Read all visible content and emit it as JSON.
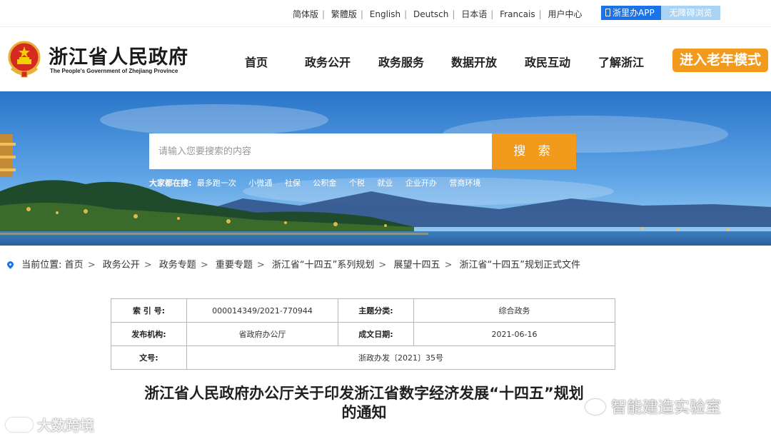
{
  "topbar": {
    "languages": [
      "简体版",
      "繁體版",
      "English",
      "Deutsch",
      "日本语",
      "Francais",
      "用户中心"
    ],
    "app_button": "浙里办APP",
    "accessibility_button": "无障碍浏览"
  },
  "header": {
    "title": "浙江省人民政府",
    "subtitle": "The People's Government of Zhejiang Province",
    "nav": [
      "首页",
      "政务公开",
      "政务服务",
      "数据开放",
      "政民互动",
      "了解浙江"
    ],
    "elder_mode": "进入老年模式"
  },
  "search": {
    "placeholder": "请输入您要搜索的内容",
    "button": "搜 索",
    "hot_label": "大家都在搜:",
    "hot_items": [
      "最多跑一次",
      "小微通",
      "社保",
      "公积金",
      "个税",
      "就业",
      "企业开办",
      "营商环境"
    ]
  },
  "breadcrumb": {
    "label": "当前位置:",
    "items": [
      "首页",
      "政务公开",
      "政务专题",
      "重要专题",
      "浙江省“十四五”系列规划",
      "展望十四五",
      "浙江省“十四五”规划正式文件"
    ]
  },
  "info_table": {
    "index_label": "索 引 号:",
    "index_value": "000014349/2021-770944",
    "topic_label": "主题分类:",
    "topic_value": "综合政务",
    "issuer_label": "发布机构:",
    "issuer_value": "省政府办公厅",
    "date_label": "成文日期:",
    "date_value": "2021-06-16",
    "docno_label": "文号:",
    "docno_value": "浙政办发〔2021〕35号"
  },
  "document": {
    "title_line1": "浙江省人民政府办公厅关于印发浙江省数字经济发展“十四五”规划",
    "title_line2": "的通知"
  },
  "watermarks": {
    "left": "大数跨境",
    "right": "智能建造实验室"
  },
  "colors": {
    "accent_orange": "#f19a1c",
    "accent_blue": "#1a73e8"
  }
}
